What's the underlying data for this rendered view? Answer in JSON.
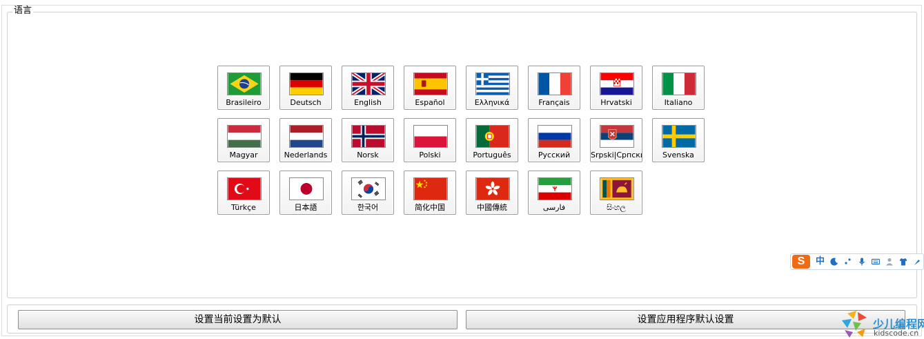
{
  "language_group": {
    "title": "语言"
  },
  "languages": [
    {
      "label": "Brasileiro",
      "flag": "brazil-flag-icon"
    },
    {
      "label": "Deutsch",
      "flag": "germany-flag-icon"
    },
    {
      "label": "English",
      "flag": "uk-flag-icon"
    },
    {
      "label": "Español",
      "flag": "spain-flag-icon"
    },
    {
      "label": "Ελληνικά",
      "flag": "greece-flag-icon"
    },
    {
      "label": "Français",
      "flag": "france-flag-icon"
    },
    {
      "label": "Hrvatski",
      "flag": "croatia-flag-icon"
    },
    {
      "label": "Italiano",
      "flag": "italy-flag-icon"
    },
    {
      "label": "Magyar",
      "flag": "hungary-flag-icon"
    },
    {
      "label": "Nederlands",
      "flag": "netherlands-flag-icon"
    },
    {
      "label": "Norsk",
      "flag": "norway-flag-icon"
    },
    {
      "label": "Polski",
      "flag": "poland-flag-icon"
    },
    {
      "label": "Português",
      "flag": "portugal-flag-icon"
    },
    {
      "label": "Русский",
      "flag": "russia-flag-icon"
    },
    {
      "label": "Srpski|Српски",
      "flag": "serbia-flag-icon"
    },
    {
      "label": "Svenska",
      "flag": "sweden-flag-icon"
    },
    {
      "label": "Türkçe",
      "flag": "turkey-flag-icon"
    },
    {
      "label": "日本語",
      "flag": "japan-flag-icon"
    },
    {
      "label": "한국어",
      "flag": "korea-flag-icon"
    },
    {
      "label": "简化中国",
      "flag": "china-flag-icon"
    },
    {
      "label": "中國傳統",
      "flag": "hong-kong-flag-icon"
    },
    {
      "label": "فارسی",
      "flag": "iran-flag-icon"
    },
    {
      "label": "සිංහල",
      "flag": "sri-lanka-flag-icon"
    }
  ],
  "buttons": {
    "set_default": "设置当前设置为默认",
    "app_default": "设置应用程序默认设置"
  },
  "ime_bar": {
    "logo": "S",
    "mode": "中"
  },
  "watermark": {
    "title": "少儿编程网",
    "url": "kidscode.cn"
  }
}
